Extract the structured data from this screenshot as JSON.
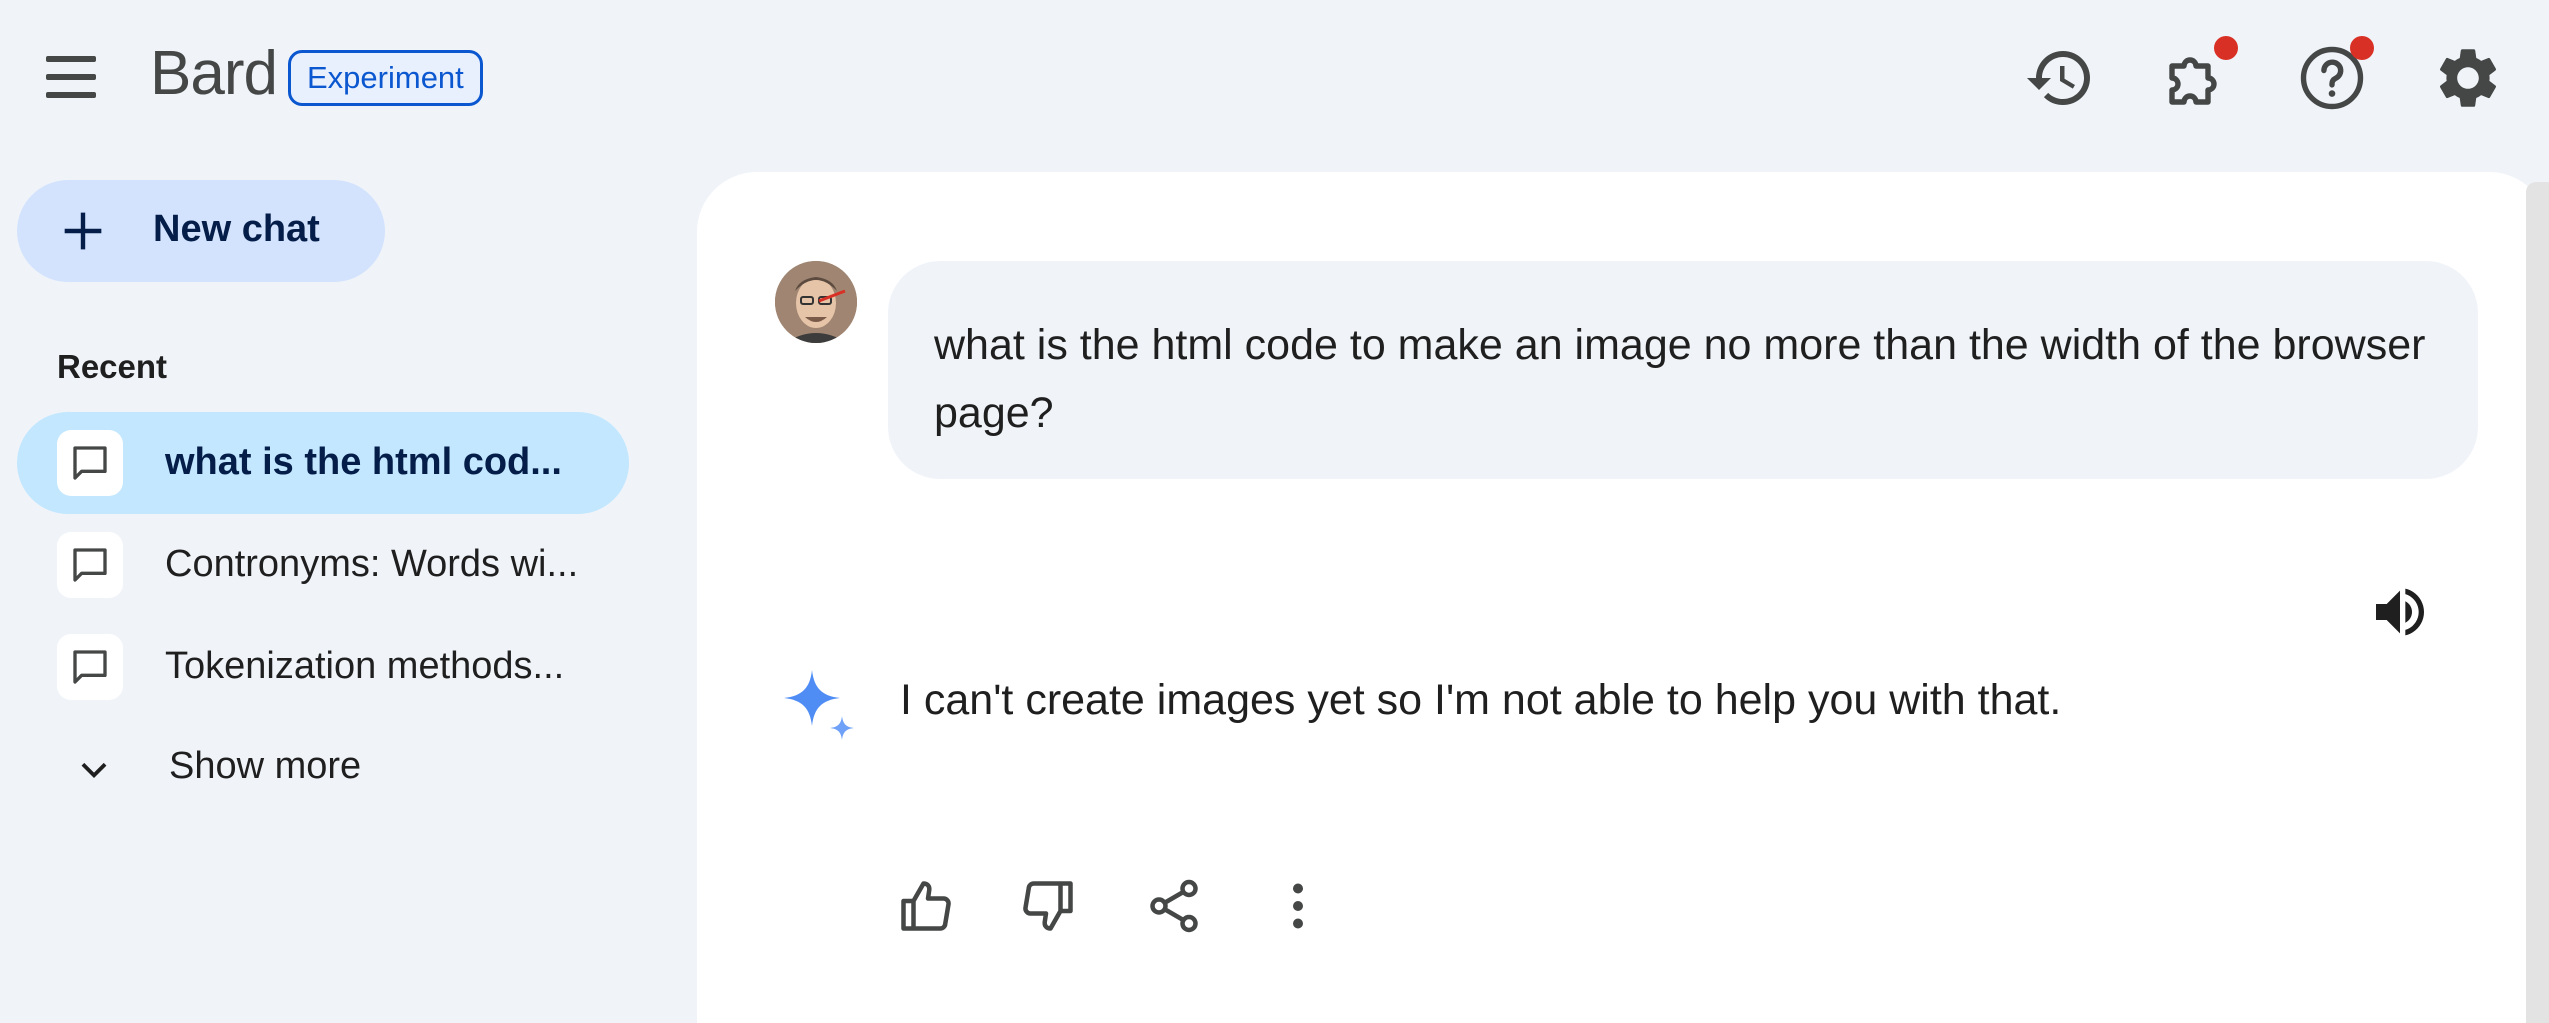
{
  "header": {
    "brand": "Bard",
    "badge": "Experiment",
    "icons": [
      "history-icon",
      "extensions-icon",
      "help-icon",
      "settings-icon"
    ],
    "notification_color": "#d93025"
  },
  "sidebar": {
    "new_chat_label": "New chat",
    "recent_title": "Recent",
    "items": [
      {
        "label": "what is the html cod...",
        "active": true
      },
      {
        "label": "Contronyms: Words wi...",
        "active": false
      },
      {
        "label": "Tokenization methods...",
        "active": false
      }
    ],
    "show_more_label": "Show more"
  },
  "conversation": {
    "user_query": "what is the html code to make an image no more than the width of the browser page?",
    "response": "I can't create images yet so I'm not able to help you with that."
  },
  "colors": {
    "accent": "#0b57d0",
    "active_item": "#c2e7ff",
    "new_chat_bg": "#d3e3fd",
    "page_bg": "#f0f4f9"
  }
}
